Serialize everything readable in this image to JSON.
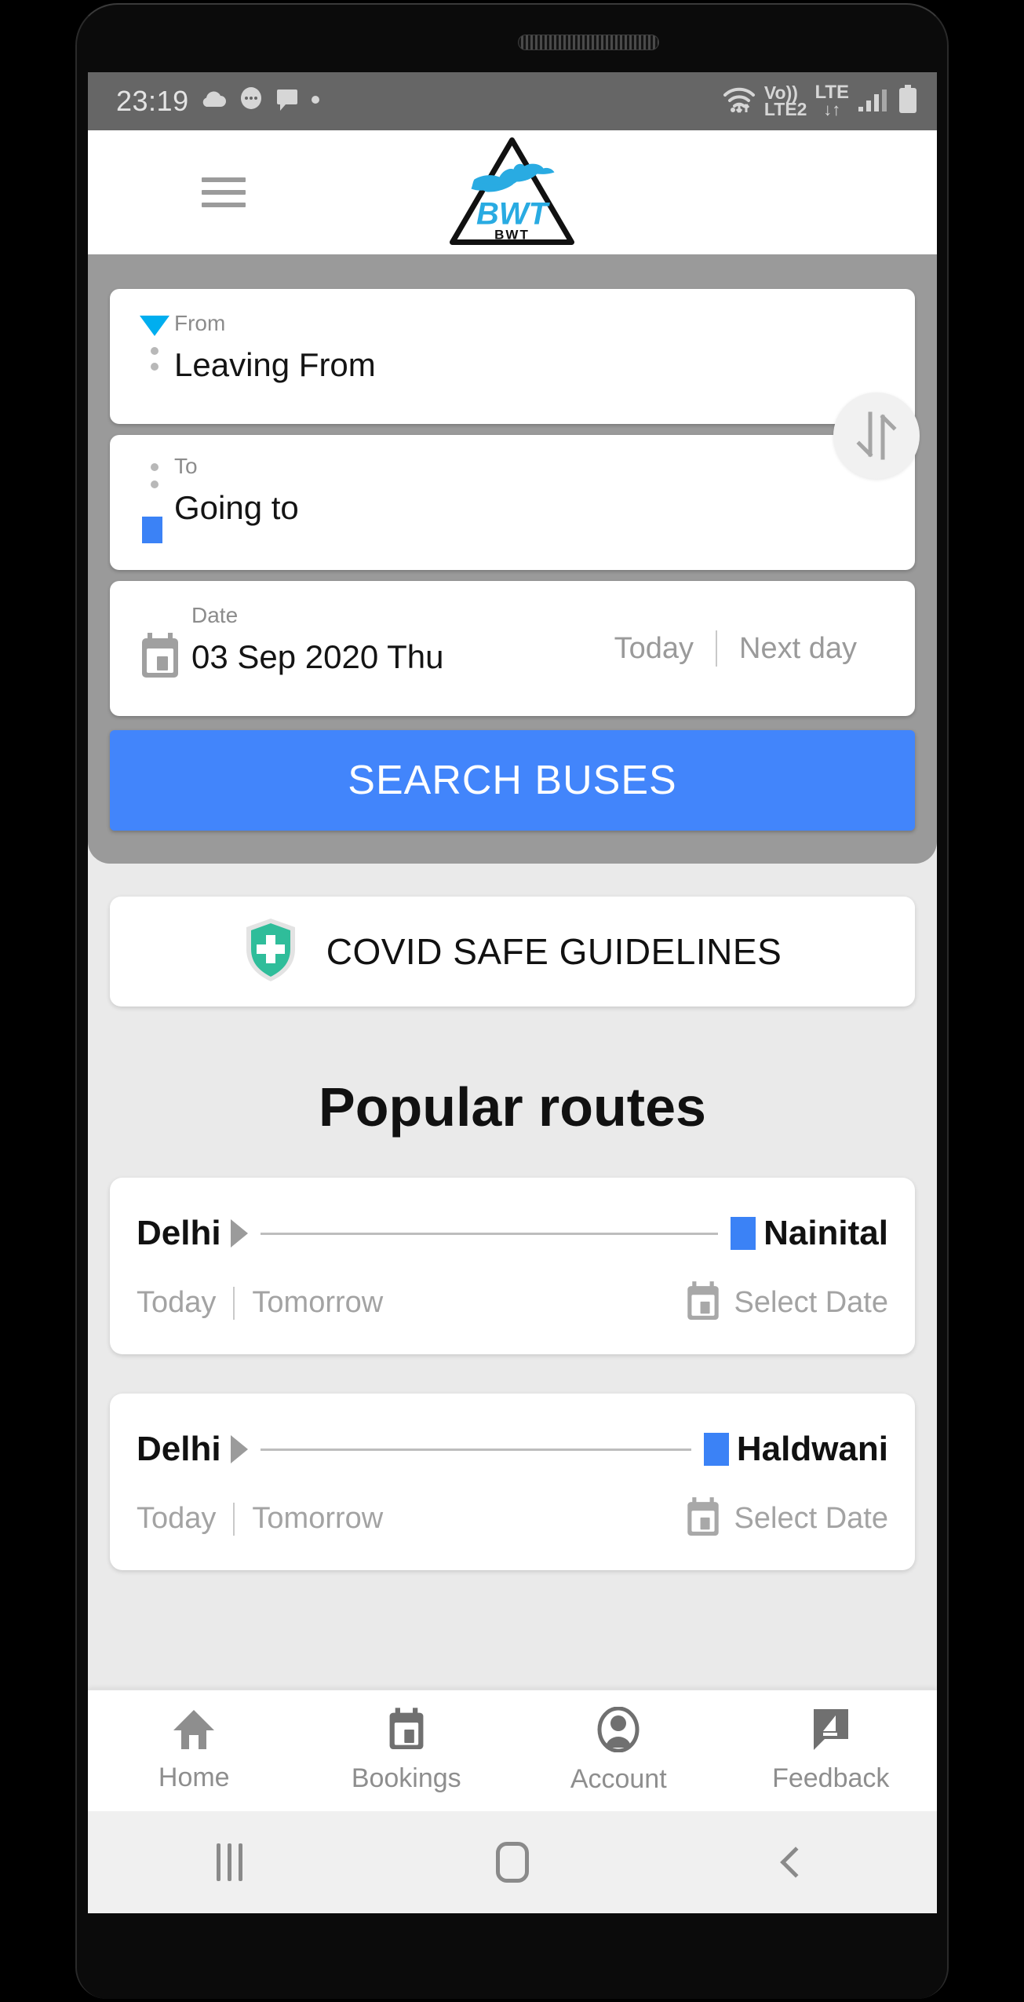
{
  "status_bar": {
    "time": "23:19",
    "left_icons": [
      "cloud-icon",
      "chat-bubble-icon",
      "message-icon",
      "dot-icon"
    ],
    "volte_line1": "Vo))",
    "volte_line2": "LTE2",
    "lte_line1": "LTE",
    "lte_line2": "↓↑",
    "right_icons": [
      "wifi-icon",
      "volte-icon",
      "lte-icon",
      "signal-icon",
      "battery-icon"
    ]
  },
  "header": {
    "menu_icon": "hamburger-menu-icon",
    "logo_alt": "BWT",
    "logo_text": "BWT",
    "logo_wordmark": "BWT"
  },
  "search": {
    "from": {
      "label": "From",
      "value": "Leaving From",
      "placeholder": "Leaving From"
    },
    "to": {
      "label": "To",
      "value": "Going to",
      "placeholder": "Going to"
    },
    "date": {
      "label": "Date",
      "value": "03 Sep 2020 Thu",
      "today_label": "Today",
      "next_day_label": "Next day"
    },
    "swap_icon": "swap-vertical-icon",
    "submit_label": "SEARCH BUSES"
  },
  "covid": {
    "label": "COVID SAFE GUIDELINES",
    "icon": "shield-plus-icon"
  },
  "popular": {
    "title": "Popular routes",
    "routes": [
      {
        "from": "Delhi",
        "to": "Nainital",
        "today_label": "Today",
        "tomorrow_label": "Tomorrow",
        "select_date_label": "Select Date"
      },
      {
        "from": "Delhi",
        "to": "Haldwani",
        "today_label": "Today",
        "tomorrow_label": "Tomorrow",
        "select_date_label": "Select Date"
      }
    ]
  },
  "bottom_nav": {
    "items": [
      {
        "label": "Home",
        "icon": "home-icon"
      },
      {
        "label": "Bookings",
        "icon": "calendar-icon"
      },
      {
        "label": "Account",
        "icon": "person-circle-icon"
      },
      {
        "label": "Feedback",
        "icon": "feedback-pencil-icon"
      }
    ]
  },
  "system_nav": {
    "recents": "recent-apps-icon",
    "home": "home-square-icon",
    "back": "back-chevron-icon"
  },
  "colors": {
    "accent_blue": "#4285fb",
    "marker_cyan": "#00AEEF",
    "marker_blue": "#3b82f6",
    "panel_gray": "#9a9a9a",
    "page_bg": "#eaeaea",
    "status_bar_gray": "#666666",
    "covid_green": "#2fbd9a"
  }
}
